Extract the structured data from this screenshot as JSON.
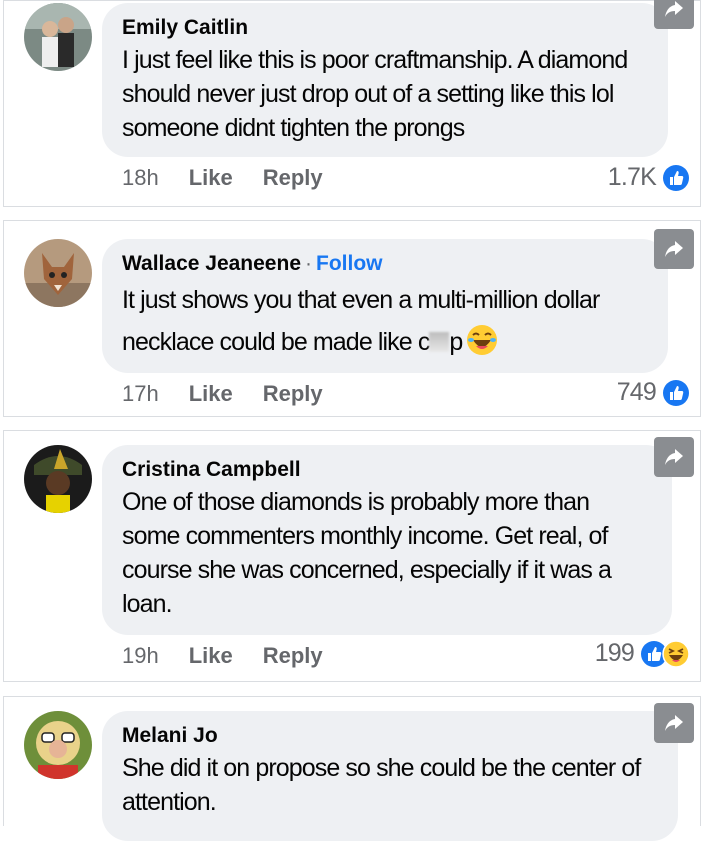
{
  "comments": [
    {
      "author": "Emily Caitlin",
      "follow": "",
      "text": "I just feel like this is poor craftmanship. A diamond should never just drop out of a setting like this lol someone didnt tighten the prongs",
      "time": "18h",
      "like": "Like",
      "reply": "Reply",
      "reaction_count": "1.7K",
      "reactions": [
        "like-icon"
      ]
    },
    {
      "author": "Wallace Jeaneene",
      "separator": "·",
      "follow": "Follow",
      "text_before": "It just shows you that even a multi-million dollar necklace could be made like c",
      "text_after": "p",
      "text_emoji": "laughing-emoji",
      "time": "17h",
      "like": "Like",
      "reply": "Reply",
      "reaction_count": "749",
      "reactions": [
        "like-icon"
      ]
    },
    {
      "author": "Cristina Campbell",
      "follow": "",
      "text": "One of those diamonds is probably more than some commenters monthly income. Get real, of course she was concerned, especially if it was a loan.",
      "time": "19h",
      "like": "Like",
      "reply": "Reply",
      "reaction_count": "199",
      "reactions": [
        "like-icon",
        "haha-icon"
      ]
    },
    {
      "author": "Melani Jo",
      "follow": "",
      "text": "She did it on propose so she could be the center of attention.",
      "time": "",
      "like": "",
      "reply": "",
      "reaction_count": "",
      "reactions": []
    }
  ],
  "colors": {
    "bubble": "#eef0f3",
    "link_blue": "#1877f2",
    "muted": "#65676b",
    "share_button": "#8a8d91"
  }
}
